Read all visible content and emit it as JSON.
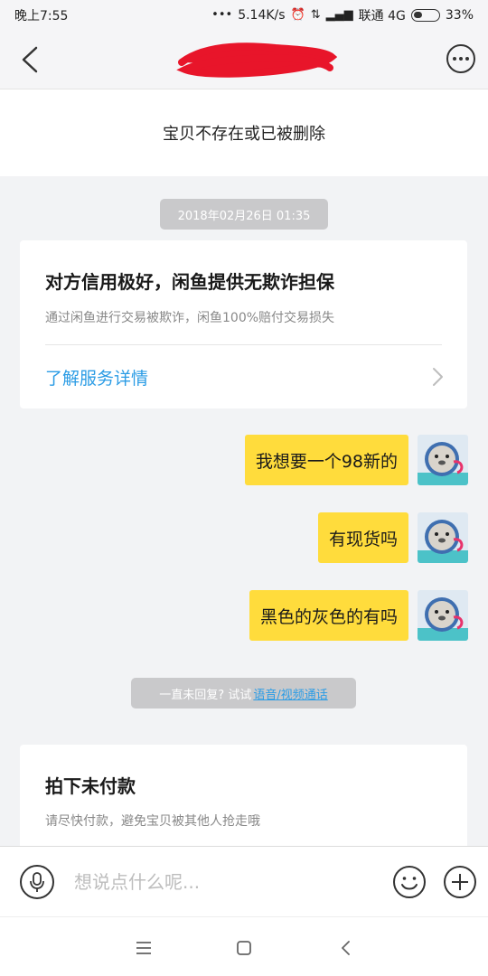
{
  "status_bar": {
    "time": "晚上7:55",
    "speed": "5.14K/s",
    "carrier": "联通 4G",
    "battery": "33%"
  },
  "nav": {
    "title": ""
  },
  "item_notice": "宝贝不存在或已被删除",
  "timestamp": "2018年02月26日 01:35",
  "guarantee": {
    "title": "对方信用极好，闲鱼提供无欺诈担保",
    "desc": "通过闲鱼进行交易被欺诈，闲鱼100%赔付交易损失",
    "link": "了解服务详情"
  },
  "messages": [
    {
      "text": "我想要一个98新的"
    },
    {
      "text": "有现货吗"
    },
    {
      "text": "黑色的灰色的有吗"
    }
  ],
  "call_hint": {
    "prefix": "一直未回复? 试试",
    "link": "语音/视频通话"
  },
  "unpaid": {
    "title": "拍下未付款",
    "desc": "请尽快付款，避免宝贝被其他人抢走哦"
  },
  "input": {
    "placeholder": "想说点什么呢..."
  },
  "colors": {
    "bubble": "#ffdc3c",
    "link": "#2b9ce5",
    "background": "#f2f3f5"
  }
}
